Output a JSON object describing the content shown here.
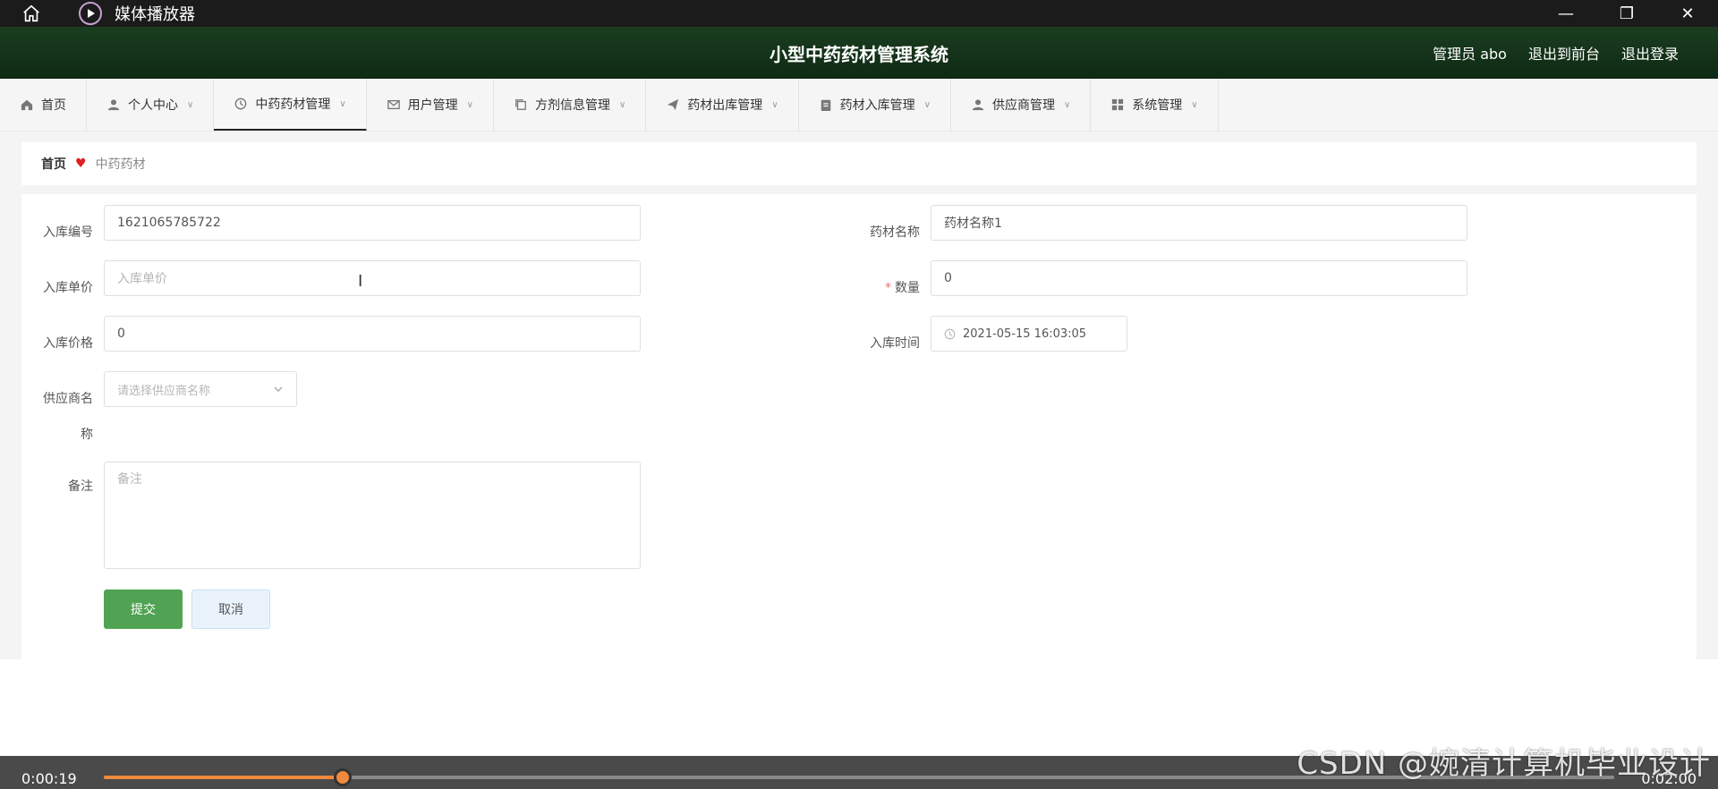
{
  "player": {
    "title": "媒体播放器",
    "minimize": "—",
    "restore": "❐",
    "close": "✕",
    "time_current": "0:00:19",
    "time_total": "0:02:00",
    "progress": 0.158
  },
  "header": {
    "system_title": "小型中药药材管理系统",
    "admin": "管理员 abo",
    "to_front": "退出到前台",
    "logout": "退出登录"
  },
  "nav": {
    "items": [
      {
        "label": "首页",
        "icon": "home-icon",
        "has_menu": false
      },
      {
        "label": "个人中心",
        "icon": "user-icon",
        "has_menu": true
      },
      {
        "label": "中药药材管理",
        "icon": "clock-icon",
        "has_menu": true,
        "active": true
      },
      {
        "label": "用户管理",
        "icon": "mail-icon",
        "has_menu": true
      },
      {
        "label": "方剂信息管理",
        "icon": "copy-icon",
        "has_menu": true
      },
      {
        "label": "药材出库管理",
        "icon": "send-icon",
        "has_menu": true
      },
      {
        "label": "药材入库管理",
        "icon": "clipboard-icon",
        "has_menu": true
      },
      {
        "label": "供应商管理",
        "icon": "user-icon",
        "has_menu": true
      },
      {
        "label": "系统管理",
        "icon": "grid-icon",
        "has_menu": true
      }
    ],
    "chevron": "∨"
  },
  "breadcrumb": {
    "home": "首页",
    "heart": "♥",
    "current": "中药药材"
  },
  "form": {
    "stock_no_label": "入库编号",
    "stock_no_value": "1621065785722",
    "herb_name_label": "药材名称",
    "herb_name_value": "药材名称1",
    "unit_price_label": "入库单价",
    "unit_price_placeholder": "入库单价",
    "quantity_label": "数量",
    "quantity_required": "*",
    "quantity_value": "0",
    "price_label": "入库价格",
    "price_value": "0",
    "time_label": "入库时间",
    "time_value": "2021-05-15 16:03:05",
    "supplier_label_1": "供应商名",
    "supplier_label_2": "称",
    "supplier_placeholder": "请选择供应商名称",
    "remark_label": "备注",
    "remark_placeholder": "备注",
    "submit": "提交",
    "cancel": "取消"
  },
  "watermark": "CSDN @婉清计算机毕业设计"
}
